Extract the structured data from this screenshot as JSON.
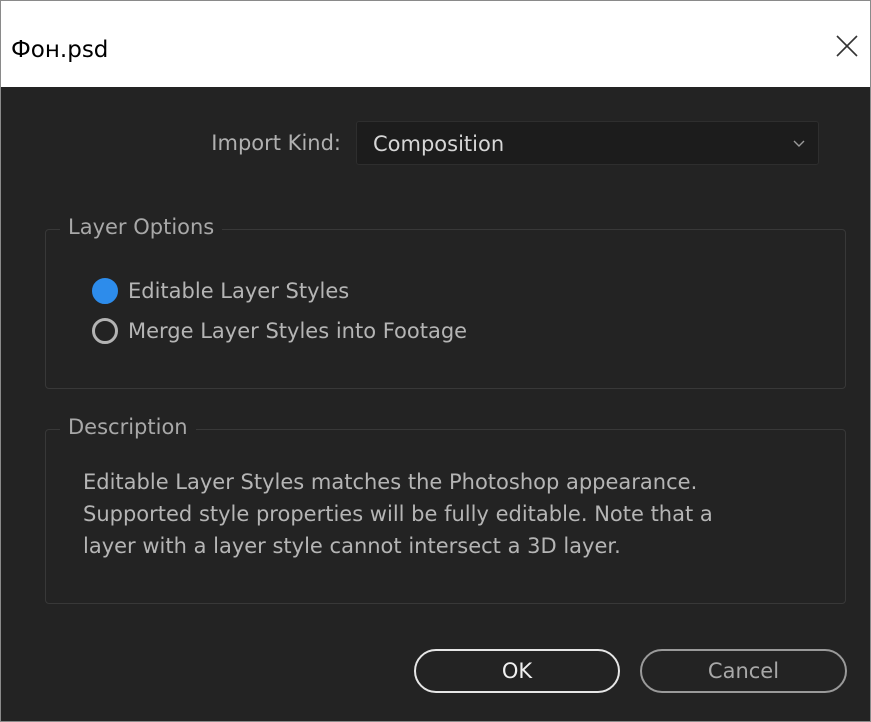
{
  "window": {
    "title": "Фон.psd"
  },
  "import": {
    "label": "Import Kind:",
    "selected": "Composition"
  },
  "layer_options": {
    "legend": "Layer Options",
    "options": [
      {
        "label": "Editable Layer Styles",
        "checked": true
      },
      {
        "label": "Merge Layer Styles into Footage",
        "checked": false
      }
    ]
  },
  "description": {
    "legend": "Description",
    "lines": [
      "Editable Layer Styles matches the Photoshop appearance.",
      "Supported style properties will be fully editable. Note that a",
      "layer with a layer style cannot intersect a 3D layer."
    ]
  },
  "buttons": {
    "ok": "OK",
    "cancel": "Cancel"
  },
  "icons": {
    "close": "close-icon",
    "chevron": "chevron-down-icon"
  },
  "colors": {
    "background": "#232323",
    "accent": "#2d8ceb",
    "titlebar": "#ffffff"
  }
}
